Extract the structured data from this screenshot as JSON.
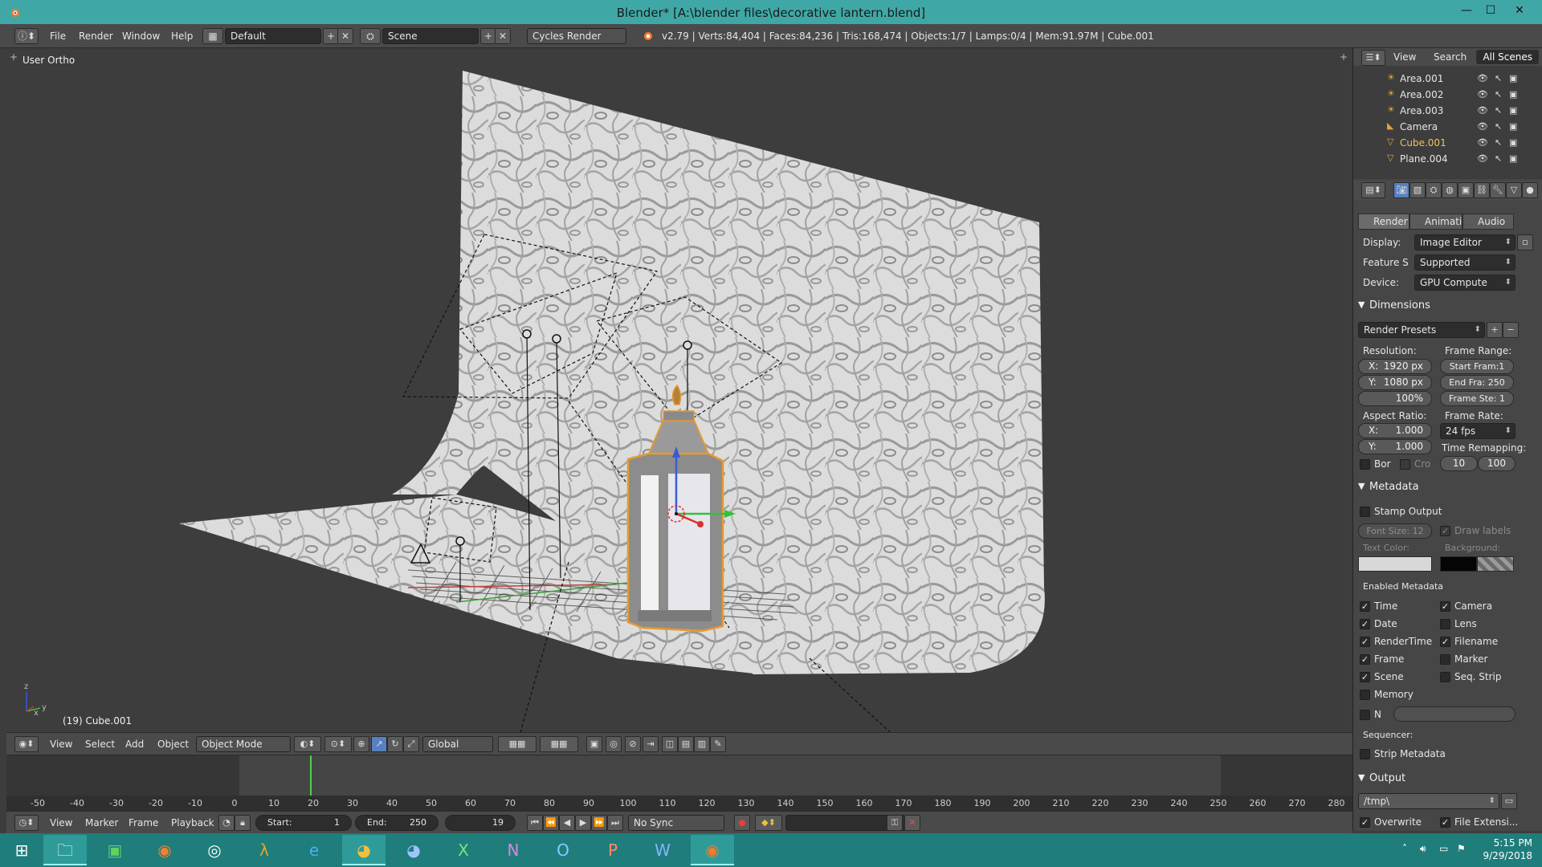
{
  "window": {
    "title": "Blender* [A:\\blender files\\decorative lantern.blend]",
    "minimize": "—",
    "maximize": "☐",
    "close": "✕"
  },
  "infobar": {
    "menus": [
      "File",
      "Render",
      "Window",
      "Help"
    ],
    "layout": "Default",
    "scene": "Scene",
    "engine": "Cycles Render",
    "stats": "v2.79 | Verts:84,404 | Faces:84,236 | Tris:168,474 | Objects:1/7 | Lamps:0/4 | Mem:91.97M | Cube.001"
  },
  "viewport": {
    "view_label": "User Ortho",
    "active_object": "(19) Cube.001",
    "axis_x": "x",
    "axis_y": "y",
    "axis_z": "z"
  },
  "view_header": {
    "menus": [
      "View",
      "Select",
      "Add",
      "Object"
    ],
    "mode": "Object Mode",
    "orientation": "Global"
  },
  "timeline": {
    "ticks": [
      "-50",
      "-40",
      "-30",
      "-20",
      "-10",
      "0",
      "10",
      "20",
      "30",
      "40",
      "50",
      "60",
      "70",
      "80",
      "90",
      "100",
      "110",
      "120",
      "130",
      "140",
      "150",
      "160",
      "170",
      "180",
      "190",
      "200",
      "210",
      "220",
      "230",
      "240",
      "250",
      "260",
      "270",
      "280"
    ],
    "menus": [
      "View",
      "Marker",
      "Frame",
      "Playback"
    ],
    "start_label": "Start:",
    "start_value": "1",
    "end_label": "End:",
    "end_value": "250",
    "current_frame": "19",
    "sync": "No Sync"
  },
  "outliner": {
    "menus": [
      "View",
      "Search"
    ],
    "filter": "All Scenes",
    "items": [
      {
        "name": "Area.001",
        "icon": "lamp-icon"
      },
      {
        "name": "Area.002",
        "icon": "lamp-icon"
      },
      {
        "name": "Area.003",
        "icon": "lamp-icon"
      },
      {
        "name": "Camera",
        "icon": "camera-icon"
      },
      {
        "name": "Cube.001",
        "icon": "mesh-icon"
      },
      {
        "name": "Plane.004",
        "icon": "mesh-icon"
      }
    ]
  },
  "properties": {
    "tabs": [
      "Render",
      "Animatio",
      "Audio"
    ],
    "display_label": "Display:",
    "display_value": "Image Editor",
    "feature_label": "Feature S",
    "feature_value": "Supported",
    "device_label": "Device:",
    "device_value": "GPU Compute",
    "dimensions": {
      "title": "Dimensions",
      "presets": "Render Presets",
      "resolution_label": "Resolution:",
      "res_x_label": "X:",
      "res_x": "1920 px",
      "res_y_label": "Y:",
      "res_y": "1080 px",
      "res_pct": "100%",
      "frame_range_label": "Frame Range:",
      "start_frame": "Start Fram:1",
      "end_frame": "End Fra: 250",
      "frame_step": "Frame Ste: 1",
      "aspect_label": "Aspect Ratio:",
      "aspect_x_label": "X:",
      "aspect_x": "1.000",
      "aspect_y_label": "Y:",
      "aspect_y": "1.000",
      "frame_rate_label": "Frame Rate:",
      "frame_rate": "24 fps",
      "time_remap_label": "Time Remapping:",
      "remap_old": "10",
      "remap_new": "100",
      "border_label": "Bor",
      "crop_label": "Cro"
    },
    "metadata": {
      "title": "Metadata",
      "stamp_output": "Stamp Output",
      "font_size": "Font Size: 12",
      "draw_labels": "Draw labels",
      "text_color_label": "Text Color:",
      "background_label": "Background:",
      "enabled_label": "Enabled Metadata",
      "left_items": [
        {
          "label": "Time",
          "checked": true
        },
        {
          "label": "Date",
          "checked": true
        },
        {
          "label": "RenderTime",
          "checked": true
        },
        {
          "label": "Frame",
          "checked": true
        },
        {
          "label": "Scene",
          "checked": true
        },
        {
          "label": "Memory",
          "checked": false
        }
      ],
      "right_items": [
        {
          "label": "Camera",
          "checked": true
        },
        {
          "label": "Lens",
          "checked": false
        },
        {
          "label": "Filename",
          "checked": true
        },
        {
          "label": "Marker",
          "checked": false
        },
        {
          "label": "Seq. Strip",
          "checked": false
        }
      ],
      "note_label": "N",
      "sequencer_label": "Sequencer:",
      "strip_metadata": "Strip Metadata"
    },
    "output": {
      "title": "Output",
      "path": "/tmp\\",
      "overwrite": "Overwrite",
      "file_ext": "File Extensi..."
    }
  },
  "taskbar": {
    "time": "5:15 PM",
    "date": "9/29/2018"
  },
  "colors": {
    "titlebar": "#3fa8a6",
    "taskbar": "#1f7d7b",
    "selection": "#f0a030"
  }
}
